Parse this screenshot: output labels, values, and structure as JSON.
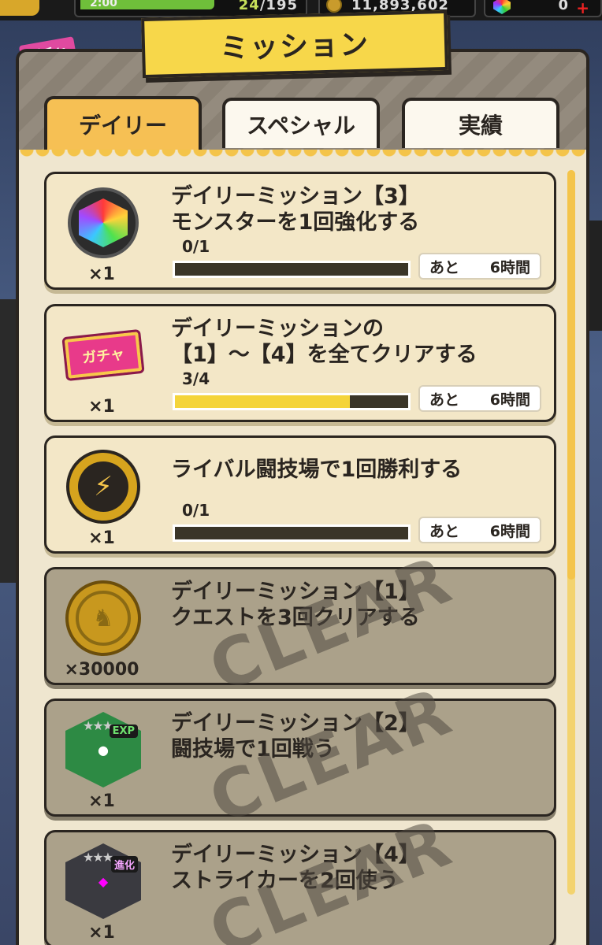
{
  "hud": {
    "stamina_timer": "2:00",
    "stamina_current": "24",
    "stamina_max": "/195",
    "coins": "11,893,602",
    "gems": "0",
    "gem_plus": "+"
  },
  "gacha_tag": "ガチャ",
  "header": {
    "title": "ミッション"
  },
  "tabs": [
    {
      "label": "デイリー",
      "active": true
    },
    {
      "label": "スペシャル",
      "active": false
    },
    {
      "label": "実績",
      "active": false
    }
  ],
  "missions": [
    {
      "title_line1": "デイリーミッション【3】",
      "title_line2": "モンスターを1回強化する",
      "qty": "×1",
      "icon": "rainbow-gem-icon",
      "progress_text": "0/1",
      "progress": 0,
      "time_label": "あと",
      "time_value": "6時間",
      "cleared": false
    },
    {
      "title_line1": "デイリーミッションの",
      "title_line2": "【1】～【4】を全てクリアする",
      "qty": "×1",
      "icon": "gacha-ticket-icon",
      "icon_text": "ガチャ",
      "progress_text": "3/4",
      "progress": 0.75,
      "time_label": "あと",
      "time_value": "6時間",
      "cleared": false
    },
    {
      "title_line1": "ライバル闘技場で1回勝利する",
      "title_line2": "",
      "qty": "×1",
      "icon": "rival-medal-icon",
      "progress_text": "0/1",
      "progress": 0,
      "time_label": "あと",
      "time_value": "6時間",
      "cleared": false
    },
    {
      "title_line1": "デイリーミッション【1】",
      "title_line2": "クエストを3回クリアする",
      "qty": "×30000",
      "icon": "gold-coin-icon",
      "cleared": true,
      "stamp": "CLEAR"
    },
    {
      "title_line1": "デイリーミッション【2】",
      "title_line2": "闘技場で1回戦う",
      "qty": "×1",
      "icon": "exp-monster-icon",
      "icon_badge": "EXP",
      "cleared": true,
      "stamp": "CLEAR"
    },
    {
      "title_line1": "デイリーミッション【4】",
      "title_line2": "ストライカーを2回使う",
      "qty": "×1",
      "icon": "evolution-monster-icon",
      "icon_badge": "進化",
      "cleared": true,
      "stamp": "CLEAR"
    }
  ],
  "colors": {
    "accent": "#f4c44a",
    "card_bg": "#f3e7c7",
    "card_cleared_bg": "#aba18a",
    "progress_fill": "#f4d43a"
  }
}
